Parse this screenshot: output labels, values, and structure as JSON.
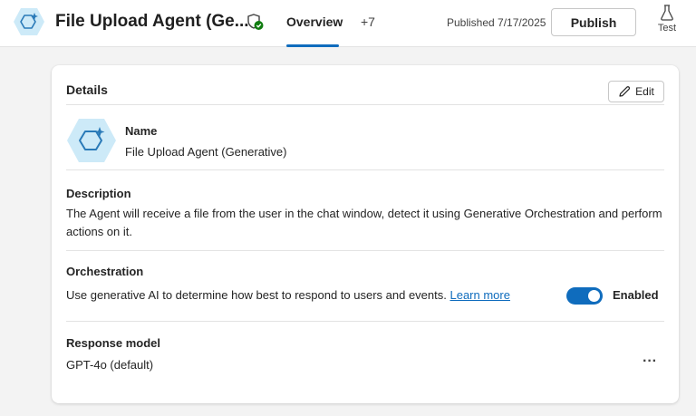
{
  "header": {
    "agent_title": "File Upload Agent (Ge...",
    "tabs": [
      {
        "label": "Overview",
        "active": true
      },
      {
        "label": "+7",
        "active": false
      }
    ],
    "published": "Published 7/17/2025",
    "publish_label": "Publish",
    "test_label": "Test"
  },
  "details": {
    "title": "Details",
    "edit_label": "Edit",
    "name_label": "Name",
    "name_value": "File Upload Agent (Generative)",
    "description_label": "Description",
    "description_value": "The Agent will receive a file from the user in the chat window, detect it using Generative Orchestration and perform actions on it.",
    "orchestration_label": "Orchestration",
    "orchestration_text": "Use generative AI to determine how best to respond to users and events.",
    "learn_more": "Learn more",
    "toggle_label": "Enabled",
    "toggle_on": true,
    "response_model_label": "Response model",
    "response_model_value": "GPT-4o (default)",
    "more_label": "···"
  },
  "colors": {
    "accent": "#0f6cbd",
    "verified_green": "#107c10"
  },
  "icons": [
    "agent-icon",
    "shield-check-icon",
    "beaker-icon",
    "pencil-icon",
    "more-horizontal-icon"
  ]
}
